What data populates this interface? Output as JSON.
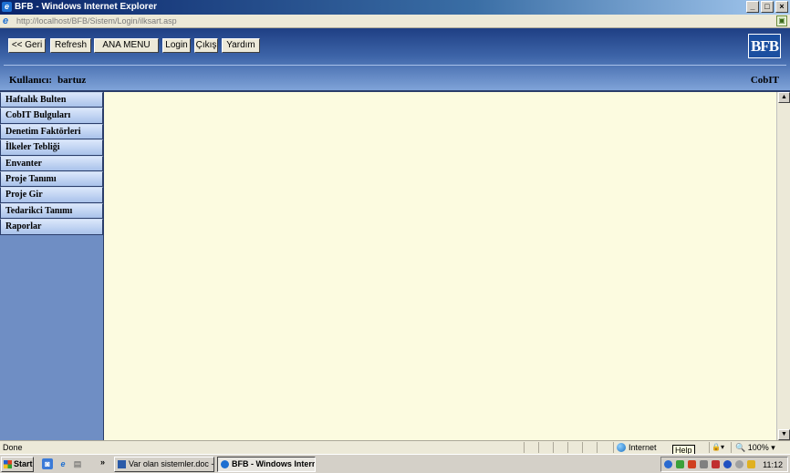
{
  "window": {
    "title": "BFB - Windows Internet Explorer",
    "address": "http://localhost/BFB/Sistem/Login/ilksart.asp",
    "address_host": "localhost",
    "controls": {
      "minimize": "_",
      "maximize": "□",
      "close": "×"
    }
  },
  "toolbar": {
    "back": "<< Geri",
    "refresh": "Refresh",
    "main_menu": "ANA MENU",
    "login": "Login",
    "logout": "Çıkış",
    "help": "Yardım"
  },
  "header": {
    "logo": "BFB",
    "user_label": "Kullanıcı:",
    "user_name": "bartuz",
    "module": "CobIT"
  },
  "sidebar": {
    "items": [
      {
        "label": "Haftalık Bulten"
      },
      {
        "label": "CobIT Bulguları"
      },
      {
        "label": "Denetim Faktörleri"
      },
      {
        "label": "İlkeler Tebliği"
      },
      {
        "label": "Envanter"
      },
      {
        "label": "Proje Tanımı"
      },
      {
        "label": "Proje Gir"
      },
      {
        "label": "Tedarikci Tanımı"
      },
      {
        "label": "Raporlar"
      }
    ]
  },
  "statusbar": {
    "status": "Done",
    "zone": "Internet",
    "zoom": "100%",
    "tooltip": "Help"
  },
  "taskbar": {
    "start": "Start",
    "tasks": [
      {
        "label": "Var olan sistemler.doc - ..."
      },
      {
        "label": "BFB - Windows Intern..."
      }
    ],
    "clock": "11:12"
  },
  "colors": {
    "header_dark": "#1e3f84",
    "sidebar_bg": "#6f8ec4",
    "content_bg": "#fcfbe0"
  }
}
